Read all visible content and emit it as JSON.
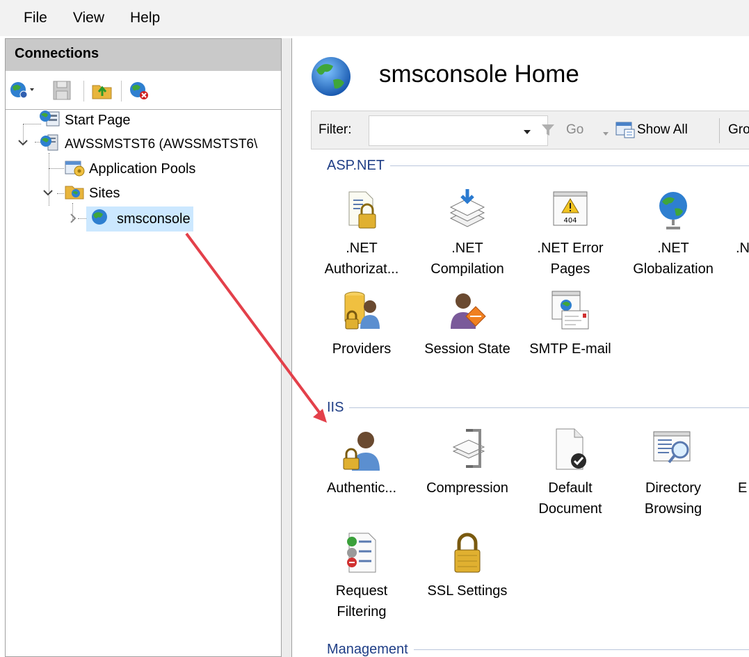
{
  "menu": {
    "file": "File",
    "view": "View",
    "help": "Help"
  },
  "connections": {
    "title": "Connections",
    "tree": {
      "start_page": "Start Page",
      "server": "AWSSMSTST6 (AWSSMSTST6\\",
      "app_pools": "Application Pools",
      "sites": "Sites",
      "site": "smsconsole"
    }
  },
  "main": {
    "title": "smsconsole Home",
    "filter": {
      "label": "Filter:",
      "value": "",
      "go": "Go",
      "show_all": "Show All",
      "group": "Gro"
    },
    "groups": {
      "aspnet": {
        "name": "ASP.NET",
        "features": [
          {
            "line1": ".NET",
            "line2": "Authorizat..."
          },
          {
            "line1": ".NET",
            "line2": "Compilation"
          },
          {
            "line1": ".NET Error",
            "line2": "Pages"
          },
          {
            "line1": ".NET",
            "line2": "Globalization"
          },
          {
            "line1": ".N",
            "line2": ""
          },
          {
            "line1": "Providers",
            "line2": ""
          },
          {
            "line1": "Session State",
            "line2": ""
          },
          {
            "line1": "SMTP E-mail",
            "line2": ""
          }
        ]
      },
      "iis": {
        "name": "IIS",
        "features": [
          {
            "line1": "Authentic...",
            "line2": ""
          },
          {
            "line1": "Compression",
            "line2": ""
          },
          {
            "line1": "Default",
            "line2": "Document"
          },
          {
            "line1": "Directory",
            "line2": "Browsing"
          },
          {
            "line1": "E",
            "line2": ""
          },
          {
            "line1": "Request",
            "line2": "Filtering"
          },
          {
            "line1": "SSL Settings",
            "line2": ""
          }
        ]
      },
      "management": {
        "name": "Management"
      }
    }
  },
  "colors": {
    "accent": "#1f3e86",
    "selection": "#cce8ff",
    "arrow": "#e3404a"
  }
}
